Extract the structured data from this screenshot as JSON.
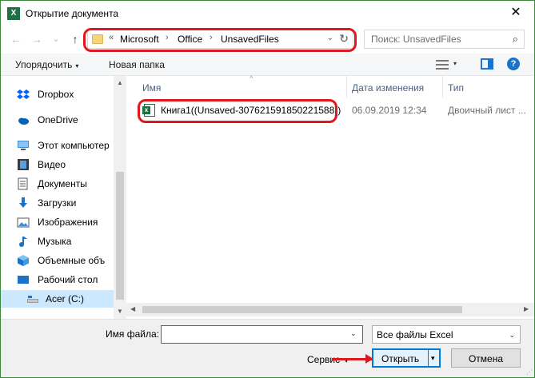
{
  "window": {
    "title": "Открытие документа",
    "app_icon": "X",
    "close": "✕"
  },
  "nav": {
    "back": "←",
    "forward": "→",
    "recent": "⌄",
    "up": "↑"
  },
  "address": {
    "overflow": "«",
    "crumbs": [
      "Microsoft",
      "Office",
      "UnsavedFiles"
    ],
    "separator": "›",
    "dropdown": "⌄",
    "refresh": "↻"
  },
  "search": {
    "placeholder": "Поиск: UnsavedFiles",
    "icon": "⌕"
  },
  "toolbar": {
    "organize": "Упорядочить",
    "new_folder": "Новая папка",
    "caret": "▾",
    "help": "?"
  },
  "sidebar": {
    "items": [
      {
        "label": "Dropbox",
        "icon": "dropbox-icon"
      },
      {
        "label": "OneDrive",
        "icon": "onedrive-icon"
      },
      {
        "label": "Этот компьютер",
        "icon": "computer-icon"
      },
      {
        "label": "Видео",
        "icon": "video-icon"
      },
      {
        "label": "Документы",
        "icon": "documents-icon"
      },
      {
        "label": "Загрузки",
        "icon": "downloads-icon"
      },
      {
        "label": "Изображения",
        "icon": "pictures-icon"
      },
      {
        "label": "Музыка",
        "icon": "music-icon"
      },
      {
        "label": "Объемные объ",
        "icon": "3d-objects-icon"
      },
      {
        "label": "Рабочий стол",
        "icon": "desktop-icon"
      },
      {
        "label": "Acer (C:)",
        "icon": "drive-icon"
      }
    ],
    "scroll_up": "▲",
    "scroll_down": "▼"
  },
  "columns": {
    "name": "Имя",
    "date": "Дата изменения",
    "type": "Тип",
    "sort_caret": "^"
  },
  "files": [
    {
      "name": "Книга1((Unsaved-307621591850221588))",
      "date": "06.09.2019 12:34",
      "type": "Двоичный лист ..."
    }
  ],
  "hscroll": {
    "left": "◀",
    "right": "▶"
  },
  "footer": {
    "file_name_label": "Имя файла:",
    "file_name_value": "",
    "file_type_filter": "Все файлы Excel",
    "dropdown": "⌄",
    "service": "Сервис",
    "service_caret": "▾",
    "open": "Открыть",
    "open_caret": "▾",
    "cancel": "Отмена",
    "grip": "⋰"
  },
  "colors": {
    "highlight_red": "#e0181e",
    "accent_blue": "#0078d7",
    "excel_green": "#1e7145",
    "folder_yellow": "#f5d57a"
  }
}
